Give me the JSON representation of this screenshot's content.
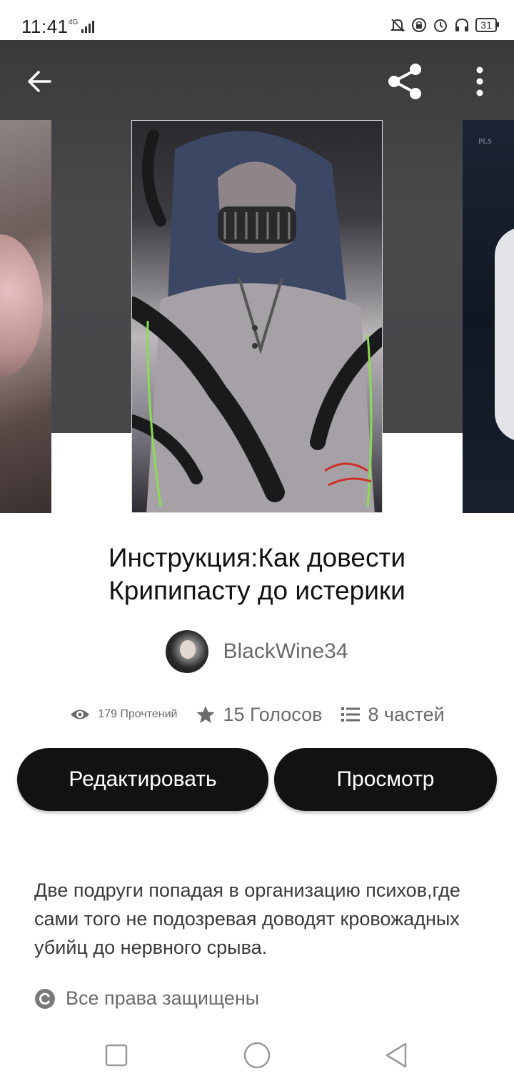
{
  "status_bar": {
    "time": "11:41",
    "network": "4G",
    "battery": "31"
  },
  "header": {
    "back_icon": "arrow-left-icon",
    "share_icon": "share-icon",
    "more_icon": "more-vertical-icon"
  },
  "story": {
    "title": "Инструкция:Как довести Крипипасту до истерики",
    "author": "BlackWine34",
    "cover_side_text": "PLS"
  },
  "stats": {
    "reads": "179 Прочтений",
    "votes": "15 Голосов",
    "parts": "8 частей"
  },
  "actions": {
    "edit_label": "Редактировать",
    "view_label": "Просмотр"
  },
  "description": "Две подруги попадая в организацию психов,где сами того не подозревая доводят кровожадных убийц до нервного срыва.",
  "rights": "Все права защищены",
  "colors": {
    "button_bg": "#121212",
    "button_text": "#ffffff",
    "hero_bg": "#3a3a3c"
  }
}
